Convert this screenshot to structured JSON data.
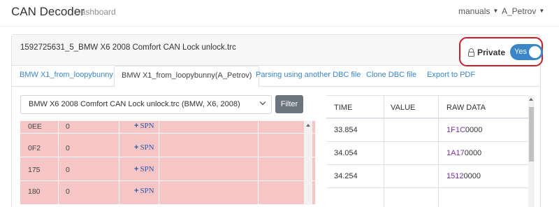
{
  "navbar": {
    "brand": "CAN Decoder",
    "dashboard_link": "Dashboard",
    "manuals_menu": "manuals",
    "user_menu": "A_Petrov"
  },
  "file": {
    "title": "1592725631_5_BMW X6 2008 Comfort CAN Lock unlock.trc"
  },
  "privacy": {
    "label": "Private",
    "toggle_text": "Yes",
    "toggle_on": true
  },
  "tabs": [
    {
      "label": "BMW X1_from_loopybunny",
      "active": false
    },
    {
      "label": "BMW X1_from_loopybunny(A_Petrov)",
      "active": true
    },
    {
      "label": "Parsing using another DBC file",
      "active": false
    },
    {
      "label": "Clone DBC file",
      "active": false
    },
    {
      "label": "Export to PDF",
      "active": false
    }
  ],
  "filter": {
    "selected": "BMW X6 2008 Comfort CAN Lock unlock.trc (BMW, X6, 2008)",
    "button": "Filter"
  },
  "messages": [
    {
      "id": "0EE",
      "count": "0",
      "spn": "SPN"
    },
    {
      "id": "0F2",
      "count": "0",
      "spn": "SPN"
    },
    {
      "id": "175",
      "count": "0",
      "spn": "SPN"
    },
    {
      "id": "180",
      "count": "0",
      "spn": "SPN"
    }
  ],
  "spn_plus": "+",
  "data_table": {
    "headers": [
      "TIME",
      "VALUE",
      "RAW DATA"
    ],
    "rows": [
      {
        "time": "33.854",
        "value": "",
        "raw_hl": "1F1C",
        "raw_rest": "0000"
      },
      {
        "time": "34.054",
        "value": "",
        "raw_hl": "1A17",
        "raw_rest": "0000"
      },
      {
        "time": "34.254",
        "value": "",
        "raw_hl": "1512",
        "raw_rest": "0000"
      },
      {
        "time": "",
        "value": "",
        "raw_hl": "",
        "raw_rest": ""
      }
    ]
  },
  "colors": {
    "accent": "#3a86c8",
    "highlight_box": "#c8202a",
    "row_highlight": "#f6c6c6",
    "raw_highlight": "#7b2fa3"
  }
}
